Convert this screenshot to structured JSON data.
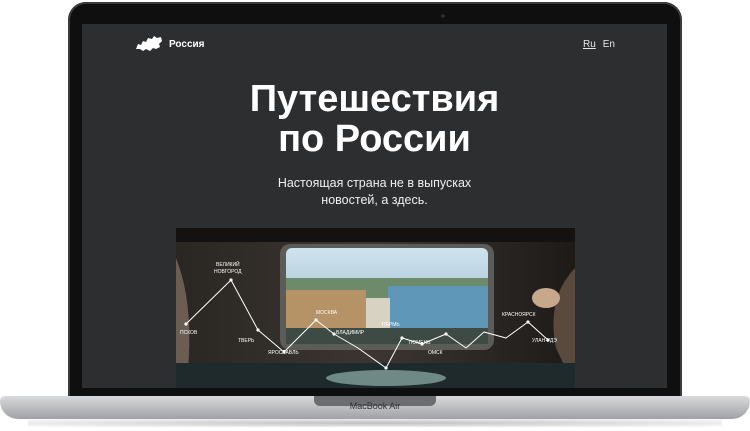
{
  "site": {
    "logo_text": "Россия",
    "languages": [
      {
        "label": "Ru",
        "active": true
      },
      {
        "label": "En",
        "active": false
      }
    ]
  },
  "hero": {
    "title_line1": "Путешествия",
    "title_line2": "по России",
    "subtitle_line1": "Настоящая страна не в выпусках",
    "subtitle_line2": "новостей, а здесь."
  },
  "route_map": {
    "stations": [
      "ВЕЛИКИЙ",
      "НОВГОРОД",
      "ПСКОВ",
      "ТВЕРЬ",
      "ЯРОСЛАВЛЬ",
      "МОСКВА",
      "ВЛАДИМИР",
      "ПЕРМЬ",
      "ТЮМЕНЬ",
      "ОМСК",
      "КРАСНОЯРСК",
      "УЛАН-УДЭ"
    ]
  },
  "device": {
    "model_label": "MacBook Air"
  }
}
